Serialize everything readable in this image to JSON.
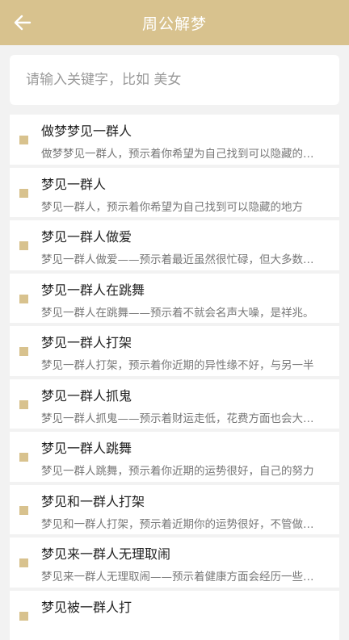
{
  "header": {
    "title": "周公解梦"
  },
  "search": {
    "placeholder": "请输入关键字，比如 美女"
  },
  "items": [
    {
      "title": "做梦梦见一群人",
      "desc": "做梦梦见一群人，预示着你希望为自己找到可以隐藏的地方"
    },
    {
      "title": "梦见一群人",
      "desc": "梦见一群人，预示着你希望为自己找到可以隐藏的地方"
    },
    {
      "title": "梦见一群人做爱",
      "desc": "梦见一群人做爱——预示着最近虽然很忙碌，但大多数时候"
    },
    {
      "title": "梦见一群人在跳舞",
      "desc": "梦见一群人在跳舞——预示着不就会名声大噪，是祥兆。"
    },
    {
      "title": "梦见一群人打架",
      "desc": "梦见一群人打架，预示着你近期的异性缘不好，与另一半"
    },
    {
      "title": "梦见一群人抓鬼",
      "desc": "梦见一群人抓鬼——预示着财运走低，花费方面也会大手大脚"
    },
    {
      "title": "梦见一群人跳舞",
      "desc": "梦见一群人跳舞，预示着你近期的运势很好，自己的努力"
    },
    {
      "title": "梦见和一群人打架",
      "desc": "梦见和一群人打架，预示着近期你的运势很好，不管做什么"
    },
    {
      "title": "梦见来一群人无理取闹",
      "desc": "梦见来一群人无理取闹——预示着健康方面会经历一些波折"
    },
    {
      "title": "梦见被一群人打",
      "desc": ""
    }
  ]
}
